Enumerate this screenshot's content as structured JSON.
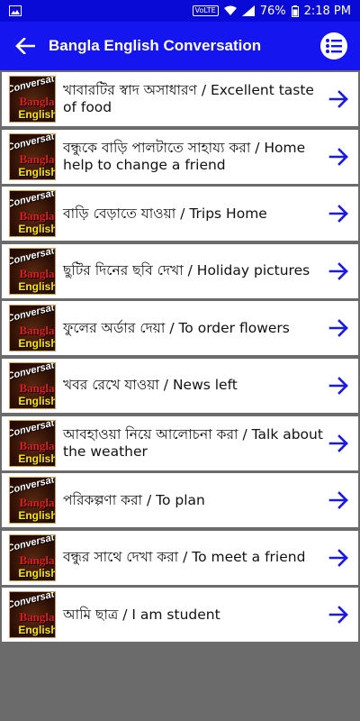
{
  "status": {
    "battery": "76%",
    "time": "2:18 PM",
    "network_badge": "VoLTE"
  },
  "appbar": {
    "title": "Bangla English Conversation"
  },
  "thumbnail": {
    "line1": "Conversation",
    "line2": "Bangla",
    "line3": "English"
  },
  "items": [
    {
      "label": "খাবারটির স্বাদ অসাধারণ / Excellent taste of food"
    },
    {
      "label": "বন্ধুকে বাড়ি পালটাতে সাহায্য করা / Home help to change a friend"
    },
    {
      "label": "বাড়ি বেড়াতে যাওয়া / Trips Home"
    },
    {
      "label": "ছুটির দিনের ছবি দেখা / Holiday pictures"
    },
    {
      "label": "ফুলের অর্ডার দেয়া / To order flowers"
    },
    {
      "label": "খবর রেখে যাওয়া / News left"
    },
    {
      "label": "আবহাওয়া নিয়ে আলোচনা করা / Talk about the weather"
    },
    {
      "label": "পরিকল্পণা করা / To plan"
    },
    {
      "label": "বন্ধুর সাথে দেখা করা / To meet a friend"
    },
    {
      "label": "আমি ছাত্র / I am student"
    }
  ],
  "colors": {
    "appbar": "#1515f0",
    "statusbar": "#0a0ad6",
    "arrow": "#1a1ae6",
    "background": "#6b6b6b"
  }
}
